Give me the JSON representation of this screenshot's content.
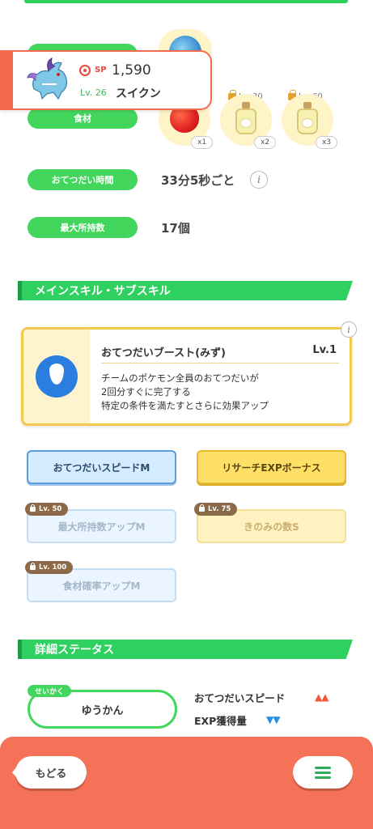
{
  "stats": {
    "berry_label": "",
    "ingredient_label": "食材",
    "help_label": "おてつだい時間",
    "help_value": "33分5秒ごと",
    "carry_label": "最大所持数",
    "carry_value": "17個"
  },
  "ingredients": [
    {
      "icon": "apple-icon",
      "qty": "x1",
      "lock": ""
    },
    {
      "icon": "milk-bottle-icon",
      "qty": "x2",
      "lock": "Lv. 30"
    },
    {
      "icon": "milk-bottle-icon",
      "qty": "x3",
      "lock": "Lv. 60"
    }
  ],
  "pokemon": {
    "sp_label": "SP",
    "sp_value": "1,590",
    "level": "Lv. 26",
    "name": "スイクン"
  },
  "sections": {
    "skills_title": "メインスキル・サブスキル",
    "details_title": "詳細ステータス"
  },
  "main_skill": {
    "name": "おてつだいブースト(みず)",
    "level": "Lv.1",
    "description": "チームのポケモン全員のおてつだいが\n2回分すぐに完了する\n特定の条件を満たすとさらに効果アップ"
  },
  "sub_skills": [
    {
      "label": "おてつだいスピードM",
      "lock": ""
    },
    {
      "label": "リサーチEXPボーナス",
      "lock": ""
    },
    {
      "label": "最大所持数アップM",
      "lock": "Lv. 50"
    },
    {
      "label": "きのみの数S",
      "lock": "Lv. 75"
    },
    {
      "label": "食材確率アップM",
      "lock": "Lv. 100"
    }
  ],
  "nature": {
    "tag": "せいかく",
    "value": "ゆうかん",
    "up_label": "おてつだいスピード",
    "up_marks": "▲▲",
    "down_label": "EXP獲得量",
    "down_marks": "▼▼"
  },
  "footer": {
    "back_label": "もどる",
    "menu_icon": "hamburger-menu-icon"
  },
  "colors": {
    "accent_green": "#2ed160",
    "accent_orange": "#f57258",
    "skill_blue": "#2b7de0"
  }
}
